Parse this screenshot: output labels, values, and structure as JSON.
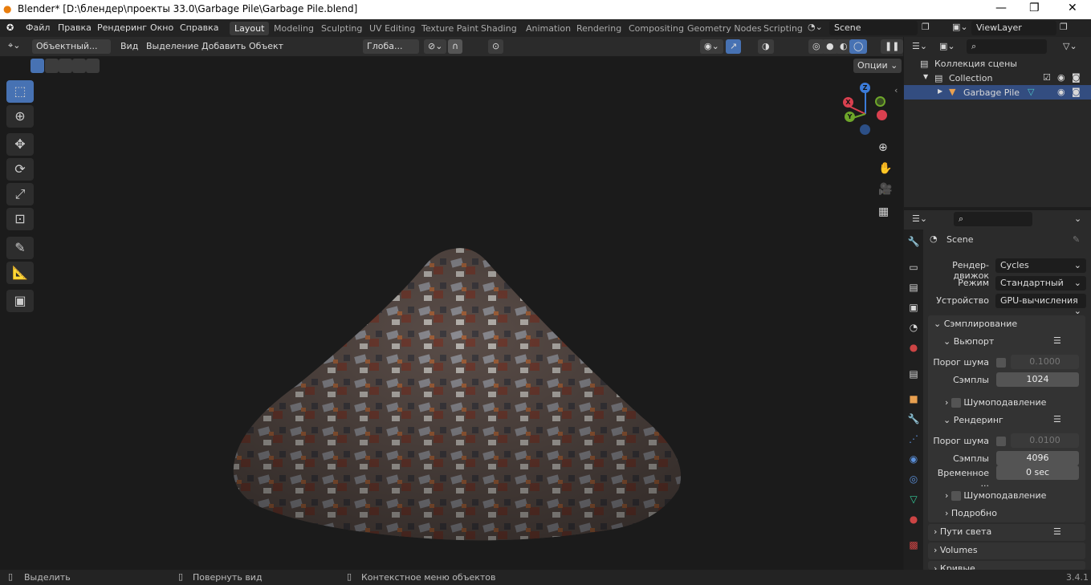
{
  "window": {
    "title": "Blender* [D:\\блендер\\проекты 33.0\\Garbage Pile\\Garbage Pile.blend]",
    "minimize": "—",
    "maximize": "❐",
    "close": "✕"
  },
  "menu": [
    "Файл",
    "Правка",
    "Рендеринг",
    "Окно",
    "Справка"
  ],
  "workspaces": [
    "Layout",
    "Modeling",
    "Sculpting",
    "UV Editing",
    "Texture Paint",
    "Shading",
    "Animation",
    "Rendering",
    "Compositing",
    "Geometry Nodes",
    "Scripting"
  ],
  "scene": "Scene",
  "view_layer": "ViewLayer",
  "viewport_header": {
    "mode": "Объектный...",
    "menus": [
      "Вид",
      "Выделение",
      "Добавить",
      "Объект"
    ],
    "orientation": "Глоба...",
    "options": "Опции"
  },
  "gizmo": {
    "x": "X",
    "y": "Y",
    "z": "Z"
  },
  "outliner": {
    "root": "Коллекция сцены",
    "collection": "Collection",
    "object": "Garbage Pile"
  },
  "properties": {
    "context": "Scene",
    "render_engine_label": "Рендер-движок",
    "render_engine": "Cycles",
    "mode_label": "Режим",
    "mode": "Стандартный",
    "device_label": "Устройство",
    "device": "GPU-вычисления",
    "sampling": "Сэмплирование",
    "viewport": "Вьюпорт",
    "render": "Рендеринг",
    "noise_label": "Порог шума",
    "samples_label": "Сэмплы",
    "time_label": "Временное ...",
    "vp_noise": "0.1000",
    "vp_samples": "1024",
    "r_noise": "0.0100",
    "r_samples": "4096",
    "r_time": "0 sec",
    "denoise": "Шумоподавление",
    "advanced": "Подробно",
    "light_paths": "Пути света",
    "volumes": "Volumes",
    "curves": "Кривые"
  },
  "status": {
    "select": "Выделить",
    "rotate": "Повернуть вид",
    "context": "Контекстное меню объектов",
    "version": "3.4.1"
  }
}
